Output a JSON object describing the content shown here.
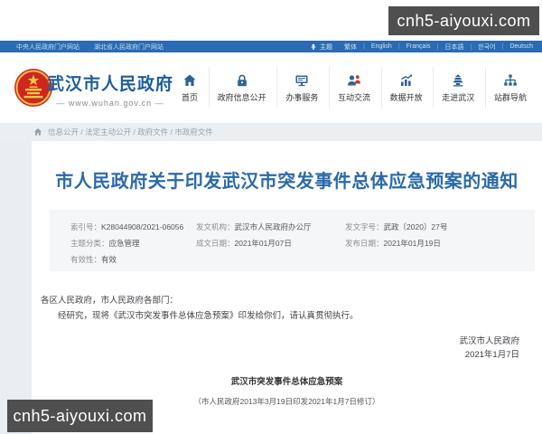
{
  "watermark": {
    "text": "cnh5-aiyouxi.com"
  },
  "topbar": {
    "links": [
      "中央人民政府门户网站",
      "湖北省人民政府门户网站"
    ],
    "theme_label": "主题",
    "languages": [
      "繁体",
      "English",
      "Français",
      "日本語",
      "한국어",
      "Deutsch"
    ]
  },
  "header": {
    "site_name": "武汉市人民政府",
    "site_url": "— www.wuhan.gov.cn —",
    "nav": [
      {
        "label": "首页",
        "icon": "home-icon"
      },
      {
        "label": "政府信息公开",
        "icon": "lock-icon"
      },
      {
        "label": "办事服务",
        "icon": "monitor-icon"
      },
      {
        "label": "互动交流",
        "icon": "people-icon"
      },
      {
        "label": "数据开放",
        "icon": "chart-icon"
      },
      {
        "label": "走进武汉",
        "icon": "tower-icon"
      },
      {
        "label": "站群导航",
        "icon": "sitemap-icon"
      }
    ]
  },
  "breadcrumb": {
    "path": "信息公开 / 法定主动公开 / 政府文件 / 市政府文件"
  },
  "document": {
    "title": "市人民政府关于印发武汉市突发事件总体应急预案的通知",
    "meta": [
      {
        "label": "索引号：",
        "value": "K28044908/2021-06056"
      },
      {
        "label": "发文机构：",
        "value": "武汉市人民政府办公厅"
      },
      {
        "label": "发文字号：",
        "value": "武政〔2020〕27号"
      },
      {
        "label": "主题分类：",
        "value": "应急管理"
      },
      {
        "label": "成文日期：",
        "value": "2021年01月07日"
      },
      {
        "label": "发布日期：",
        "value": "2021年01月19日"
      },
      {
        "label": "有效性：",
        "value": "有效"
      }
    ],
    "body": {
      "salutation": "各区人民政府，市人民政府各部门：",
      "paragraph": "经研究，现将《武汉市突发事件总体应急预案》印发给你们，请认真贯彻执行。"
    },
    "signature": {
      "org": "武汉市人民政府",
      "date": "2021年1月7日"
    },
    "attachment": {
      "title": "武汉市突发事件总体应急预案",
      "note": "（市人民政府2013年3月19日印发2021年1月7日修订）"
    }
  },
  "colors": {
    "topbar_blue": "#2a6bb3",
    "title_blue": "#2b6aa9",
    "site_name_blue": "#1d5d9f",
    "nav_icon_blue": "#2d6295",
    "badge_bg": "#4f4f50",
    "breadcrumb_bg": "#eceff2",
    "meta_box_bg": "#f4f6f7",
    "page_bg": "#e9eef3"
  }
}
